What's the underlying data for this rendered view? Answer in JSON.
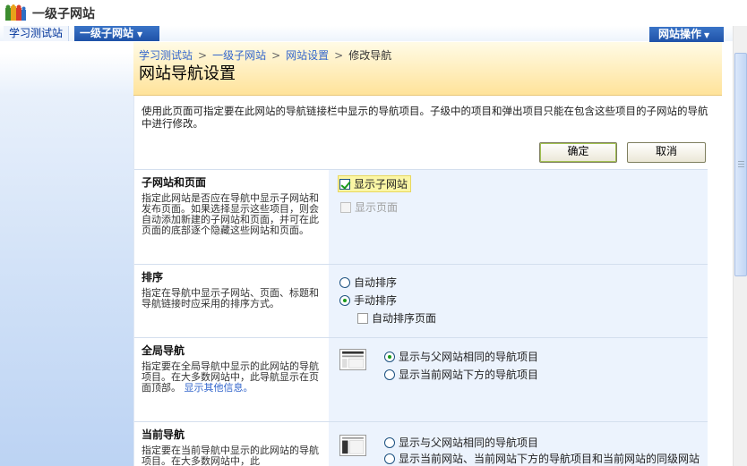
{
  "site": {
    "title": "一级子网站"
  },
  "topnav": {
    "tabs": [
      {
        "label": "学习测试站",
        "active": false
      },
      {
        "label": "一级子网站",
        "active": true
      }
    ],
    "site_actions": "网站操作"
  },
  "header": {
    "breadcrumb": [
      "学习测试站",
      "一级子网站",
      "网站设置",
      "修改导航"
    ],
    "page_title": "网站导航设置"
  },
  "description": "使用此页面可指定要在此网站的导航链接栏中显示的导航项目。子级中的项目和弹出项目只能在包含这些项目的子网站的导航中进行修改。",
  "buttons": {
    "ok": "确定",
    "cancel": "取消"
  },
  "sections": {
    "subsites": {
      "title": "子网站和页面",
      "desc": "指定此网站是否应在导航中显示子网站和发布页面。如果选择显示这些项目，则会自动添加新建的子网站和页面，并可在此页面的底部逐个隐藏这些网站和页面。",
      "show_subsites": "显示子网站",
      "show_pages": "显示页面"
    },
    "sorting": {
      "title": "排序",
      "desc": "指定在导航中显示子网站、页面、标题和导航链接时应采用的排序方式。",
      "auto": "自动排序",
      "manual": "手动排序",
      "auto_pages": "自动排序页面"
    },
    "global_nav": {
      "title": "全局导航",
      "desc": "指定要在全局导航中显示的此网站的导航项目。在大多数网站中，此导航显示在页面顶部。",
      "link": "显示其他信息。",
      "opt1": "显示与父网站相同的导航项目",
      "opt2": "显示当前网站下方的导航项目"
    },
    "current_nav": {
      "title": "当前导航",
      "desc": "指定要在当前导航中显示的此网站的导航项目。在大多数网站中，此",
      "opt1": "显示与父网站相同的导航项目",
      "opt2": "显示当前网站、当前网站下方的导航项目和当前网站的同级网站"
    }
  }
}
